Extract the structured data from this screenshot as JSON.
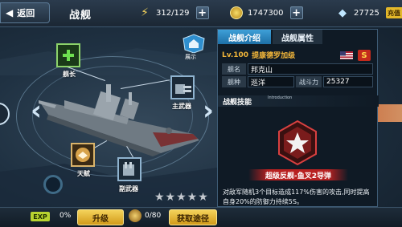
{
  "topbar": {
    "back_label": "返回",
    "title": "战舰",
    "energy": "312/129",
    "gold": "1747300",
    "diamonds": "27725",
    "recharge_label": "充值"
  },
  "ship": {
    "slots": {
      "captain": "舰长",
      "main_weapon": "主武器",
      "talent": "天赋",
      "sub_weapon": "副武器"
    },
    "display_label": "展示",
    "stars": "★★★★★"
  },
  "bottom": {
    "exp_badge": "EXP",
    "exp_value": "0%",
    "upgrade_label": "升级",
    "item_count": "0/80",
    "obtain_label": "获取途径"
  },
  "panel": {
    "tabs": [
      "战舰介绍",
      "战舰属性"
    ],
    "level": "Lv.100",
    "ship_name": "提康德罗加级",
    "name_label": "舰名",
    "name_value": "邦克山",
    "type_label": "舰种",
    "type_value": "巡洋",
    "power_label": "战斗力",
    "power_value": "25327",
    "faction_badge": "S",
    "skill_title": "战舰技能",
    "skill_intro": "Introduction",
    "skill_name": "超级反舰-鱼叉2导弹",
    "skill_desc": "对敌军随机3个目标造成117%伤害的攻击,同时提高自身20%的防御力持续5S。"
  },
  "colors": {
    "accent_blue": "#3fa0d8",
    "gold_text": "#f2b63a",
    "button_yellow": "#f4d35b",
    "skill_red": "#b82121"
  }
}
